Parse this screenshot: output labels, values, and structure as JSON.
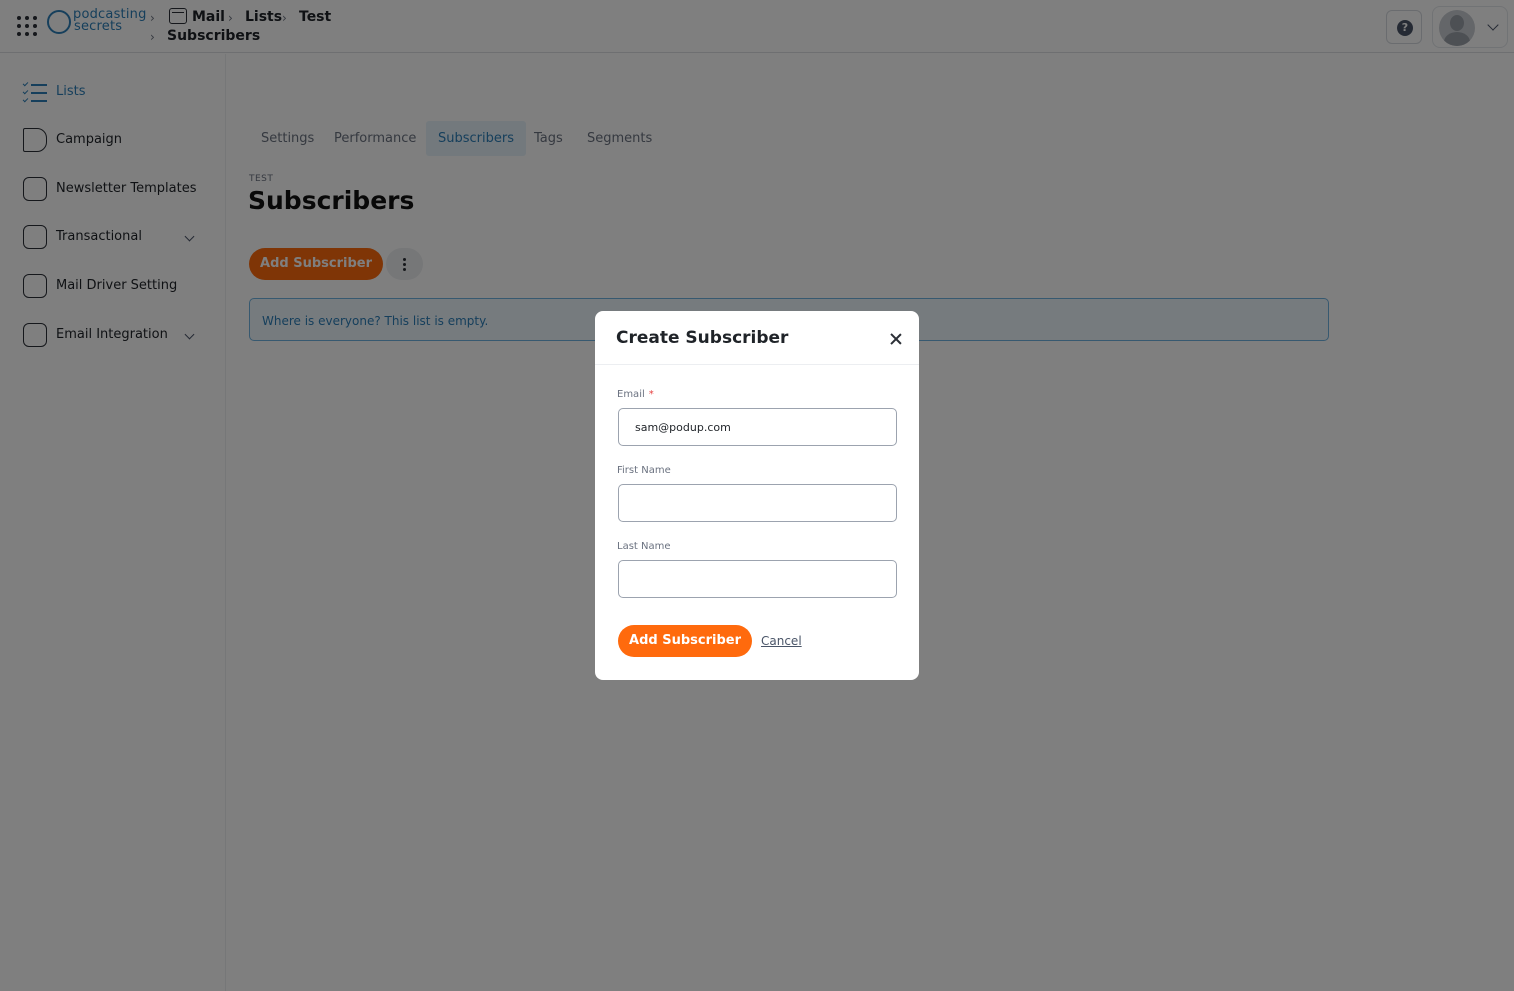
{
  "header": {
    "logo": {
      "line1": "podcasting",
      "line2": "secrets"
    },
    "breadcrumb": [
      "Mail",
      "Lists",
      "Test",
      "Subscribers"
    ]
  },
  "sidebar": {
    "items": [
      {
        "label": "Lists",
        "icon": "list-check-icon",
        "active": true
      },
      {
        "label": "Campaign",
        "icon": "megaphone-icon"
      },
      {
        "label": "Newsletter Templates",
        "icon": "template-icon"
      },
      {
        "label": "Transactional",
        "icon": "transactional-icon",
        "expandable": true
      },
      {
        "label": "Mail Driver Setting",
        "icon": "mail-driver-icon"
      },
      {
        "label": "Email Integration",
        "icon": "integration-icon",
        "expandable": true
      }
    ]
  },
  "tabs": [
    {
      "label": "Settings"
    },
    {
      "label": "Performance"
    },
    {
      "label": "Subscribers",
      "active": true
    },
    {
      "label": "Tags"
    },
    {
      "label": "Segments"
    }
  ],
  "page": {
    "eyebrow": "TEST",
    "title": "Subscribers",
    "add_button": "Add Subscriber",
    "empty_message": "Where is everyone? This list is empty."
  },
  "modal": {
    "title": "Create Subscriber",
    "email_label": "Email",
    "email_required": "*",
    "email_value": "sam@podup.com",
    "first_name_label": "First Name",
    "first_name_value": "",
    "last_name_label": "Last Name",
    "last_name_value": "",
    "submit_label": "Add Subscriber",
    "cancel_label": "Cancel"
  },
  "colors": {
    "accent": "#ff6a0d",
    "link": "#2c7fb8",
    "overlay": "rgba(0,0,0,0.5)"
  }
}
